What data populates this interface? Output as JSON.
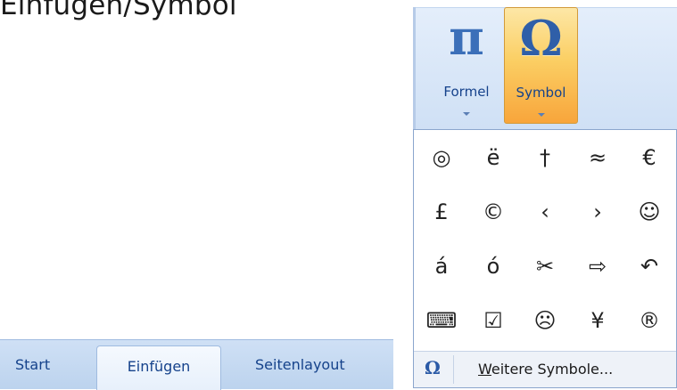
{
  "caption": "Einfügen/Symbol",
  "tabs": [
    {
      "label": "Start"
    },
    {
      "label": "Einfügen"
    },
    {
      "label": "Seitenlayout"
    }
  ],
  "ribbon": {
    "formel": {
      "glyph": "π",
      "label": "Formel"
    },
    "symbol": {
      "glyph": "Ω",
      "label": "Symbol"
    }
  },
  "symbols": [
    [
      "◎",
      "ë",
      "†",
      "≈",
      "€"
    ],
    [
      "£",
      "©",
      "‹",
      "›",
      "☺"
    ],
    [
      "á",
      "ó",
      "✂",
      "⇨",
      "↶"
    ],
    [
      "⌨",
      "☑",
      "☹",
      "¥",
      "®"
    ]
  ],
  "footer": {
    "icon": "Ω",
    "link_accel": "W",
    "link_rest": "eitere Symbole..."
  },
  "colors": {
    "accent": "#15428b",
    "active_button": "#fbcf64"
  }
}
